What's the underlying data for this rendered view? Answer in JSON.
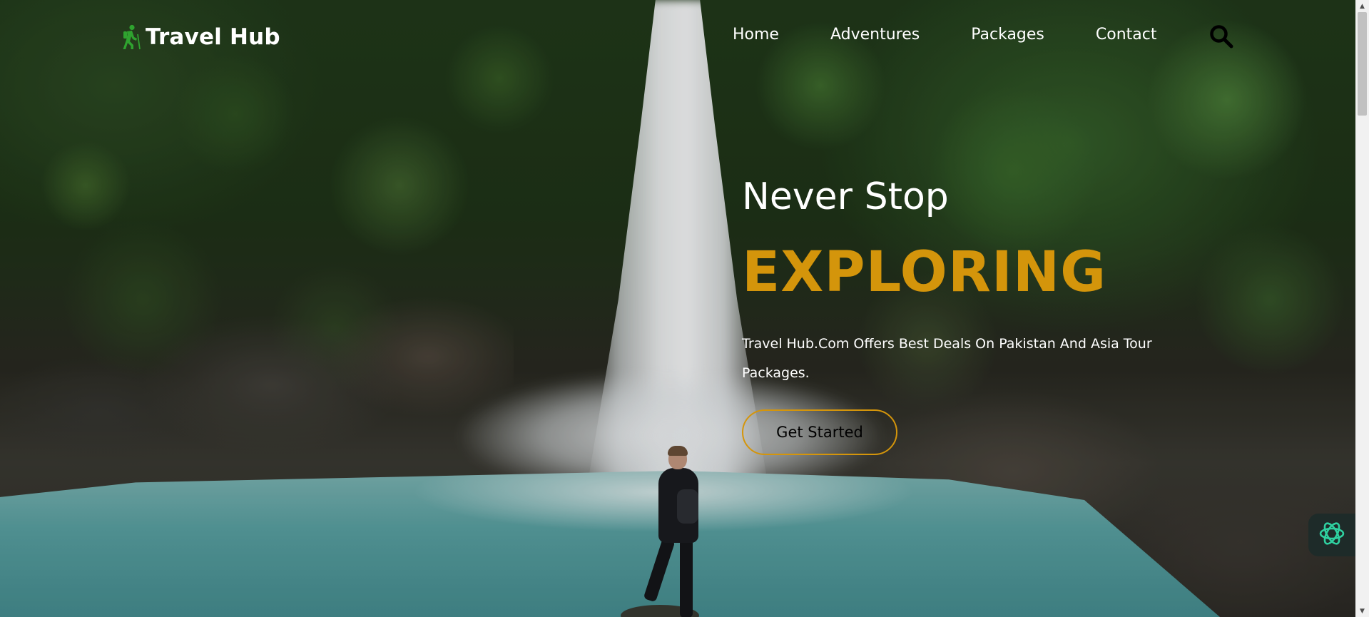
{
  "brand": {
    "name": "Travel Hub",
    "icon": "hiker-icon",
    "icon_color": "#2fa32f"
  },
  "nav": {
    "links": [
      {
        "label": "Home"
      },
      {
        "label": "Adventures"
      },
      {
        "label": "Packages"
      },
      {
        "label": "Contact"
      }
    ],
    "search_icon": "search-icon"
  },
  "hero": {
    "subtitle": "Never Stop",
    "title": "EXPLORING",
    "description": "Travel Hub.Com Offers Best Deals On Pakistan And Asia Tour Packages.",
    "cta_label": "Get Started"
  },
  "colors": {
    "accent": "#d4950b",
    "text": "#ffffff",
    "assistant_icon": "#2fd0a0"
  },
  "assistant": {
    "icon": "openai-icon"
  }
}
